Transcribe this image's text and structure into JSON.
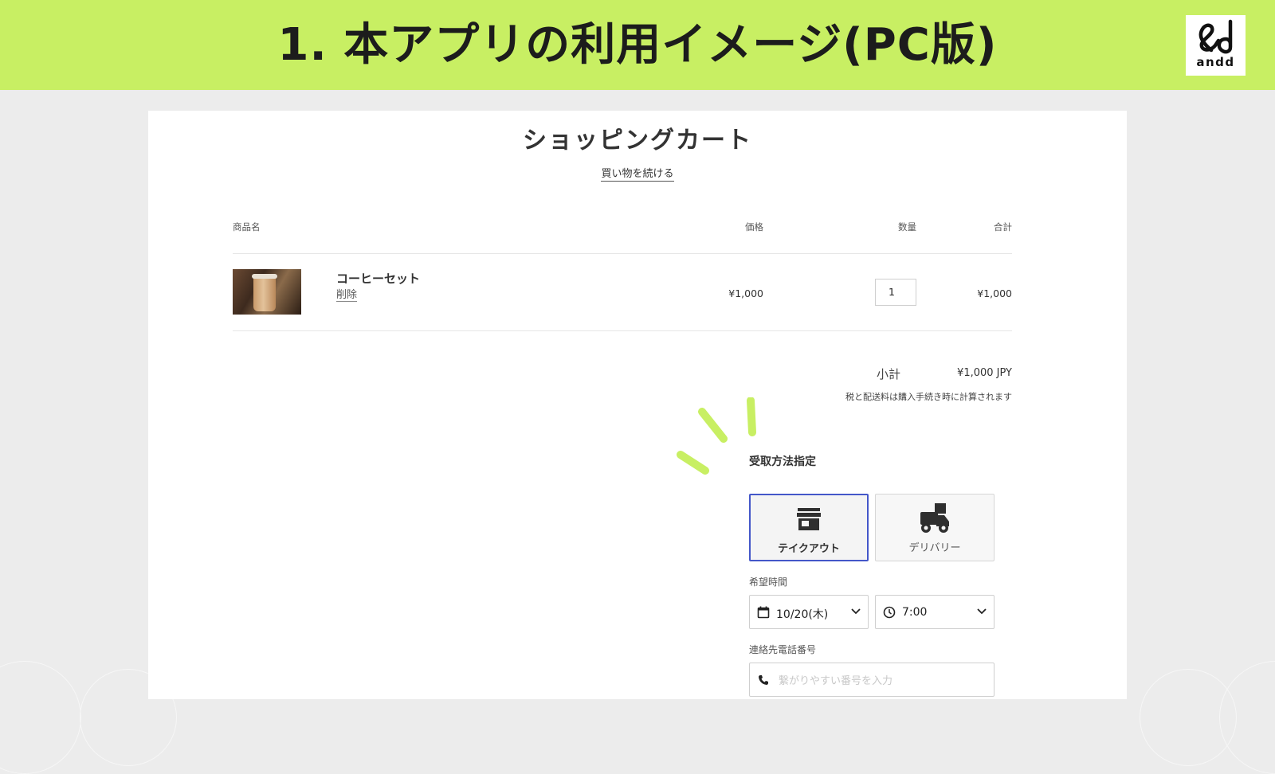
{
  "slide": {
    "title": "1. 本アプリの利用イメージ(PC版)",
    "logo_text": "andd"
  },
  "cart": {
    "title": "ショッピングカート",
    "continue_shopping": "買い物を続ける",
    "headers": {
      "product": "商品名",
      "price": "価格",
      "quantity": "数量",
      "total": "合計"
    },
    "items": [
      {
        "name": "コーヒーセット",
        "remove_label": "削除",
        "price": "¥1,000",
        "quantity": "1",
        "total": "¥1,000"
      }
    ],
    "subtotal_label": "小計",
    "subtotal_value": "¥1,000 JPY",
    "tax_note": "税と配送料は購入手続き時に計算されます"
  },
  "pickup": {
    "section_title": "受取方法指定",
    "options": [
      {
        "label": "テイクアウト",
        "icon": "storefront-icon",
        "selected": true
      },
      {
        "label": "デリバリー",
        "icon": "delivery-truck-icon",
        "selected": false
      }
    ],
    "time_label": "希望時間",
    "date_value": "10/20(木)",
    "time_value": "7:00",
    "phone_label": "連絡先電話番号",
    "phone_placeholder": "繋がりやすい番号を入力",
    "phone_value": ""
  },
  "colors": {
    "banner": "#c8ef63",
    "accent_selected": "#4457c9",
    "sparkle": "#c8ef63"
  }
}
